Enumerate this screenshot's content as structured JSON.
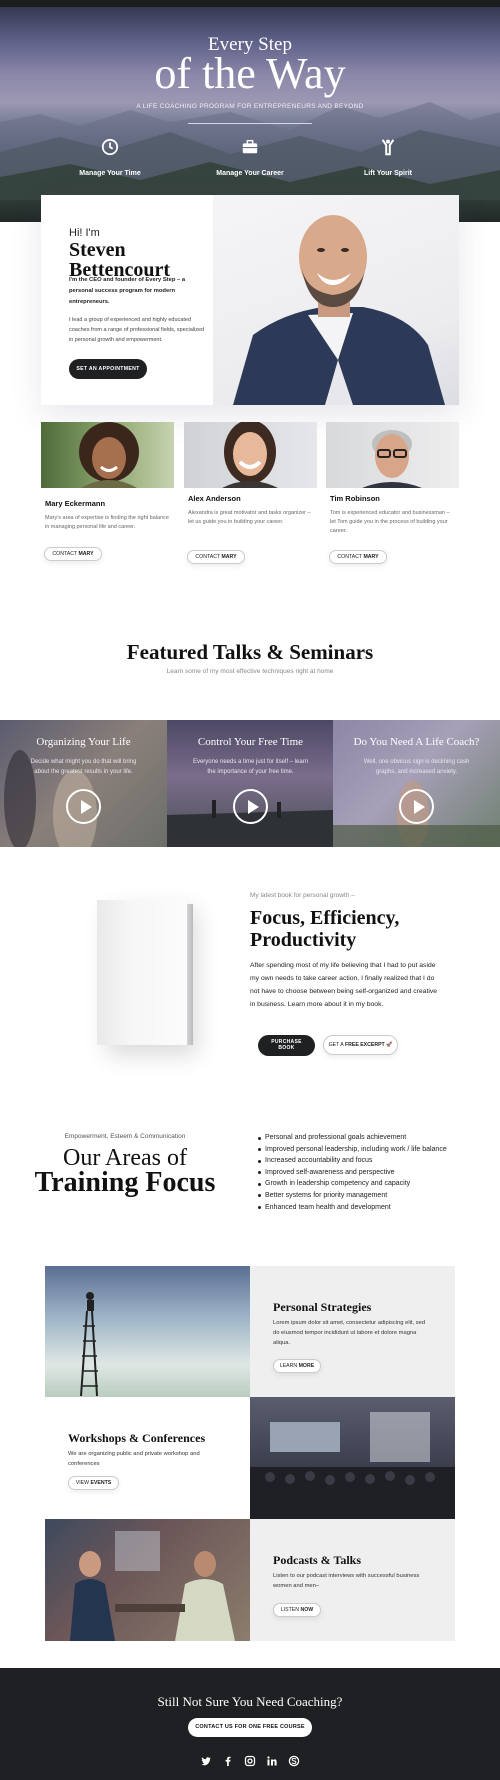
{
  "hero": {
    "title_line1": "Every Step",
    "title_line2": "of the Way",
    "subtitle": "A LIFE COACHING PROGRAM FOR ENTREPRENEURS AND BEYOND",
    "features": [
      {
        "icon": "clock-icon",
        "label": "Manage Your Time"
      },
      {
        "icon": "briefcase-icon",
        "label": "Manage Your Career"
      },
      {
        "icon": "person-raised-arms-icon",
        "label": "Lift Your Spirit"
      }
    ]
  },
  "bio": {
    "greeting": "Hi! I'm",
    "name_line1": "Steven",
    "name_line2": "Bettencourt",
    "lead": "I'm the CEO and founder of Every Step – a personal success program for modern entrepreneurs.",
    "text": "I lead a group of experienced and highly educated coaches from a range of professional fields, specialized in personal growth and empowerment.",
    "button": "SET AN APPOINTMENT"
  },
  "coaches": [
    {
      "name": "Mary Eckermann",
      "desc": "Mary's area of expertise is finding the right balance in managing personal life and career.",
      "btn_prefix": "CONTACT",
      "btn_name": "MARY"
    },
    {
      "name": "Alex Anderson",
      "desc": "Alexandra is great motivator and tasks organizer – let us guide you in building your career.",
      "btn_prefix": "CONTACT",
      "btn_name": "MARY"
    },
    {
      "name": "Tim Robinson",
      "desc": "Tom is experienced educator and businessman – let Tom guide you in the process of building your career.",
      "btn_prefix": "CONTACT",
      "btn_name": "MARY"
    }
  ],
  "featured": {
    "title": "Featured Talks & Seminars",
    "subtitle": "Learn some of my most effective techniques right at home",
    "talks": [
      {
        "title": "Organizing Your Life",
        "desc": "Decide what might you do that will bring about the greatest results in your life."
      },
      {
        "title": "Control Your Free Time",
        "desc": "Everyone needs a time just for itself – learn the importance of your free time."
      },
      {
        "title": "Do You Need A Life Coach?",
        "desc": "Well, one obvious sign is declining cash graphs, and increased anxiety."
      }
    ]
  },
  "book": {
    "kicker": "My latest book for personal growth –",
    "title": "Focus, Efficiency, Productivity",
    "text": "After spending most of my life believing that I had to put aside my own needs to take career action, I finally realized that I do not have to choose between being self-organized and creative in business. Learn more about it in my book.",
    "buy_label_line1": "PURCHASE",
    "buy_label_line2": "BOOK",
    "excerpt_prefix": "GET A",
    "excerpt_bold": "FREE EXCERPT",
    "excerpt_icon": "🚀"
  },
  "training": {
    "kicker": "Empowerment, Esteem & Communication",
    "title_line1": "Our Areas of",
    "title_line2": "Training Focus",
    "items": [
      "Personal and professional goals achievement",
      "Improved personal leadership, including work / life balance",
      "Increased accountability and focus",
      "Improved self-awareness and perspective",
      "Growth in leadership competency and capacity",
      "Better systems for priority management",
      "Enhanced team health and development"
    ]
  },
  "grid": [
    {
      "title": "Personal Strategies",
      "text": "Lorem ipsum dolor sit amet, consectetur adipiscing elit, sed do eiusmod tempor incididunt ut labore et dolore magna aliqua.",
      "btn_prefix": "LEARN",
      "btn_bold": "MORE"
    },
    {
      "title": "Workshops & Conferences",
      "text": "We are organizing public and private workshop and conferences",
      "btn_prefix": "VIEW",
      "btn_bold": "EVENTS"
    },
    {
      "title": "Podcasts & Talks",
      "text": "Listen to our podcast interviews with successful business women and men–",
      "btn_prefix": "LISTEN",
      "btn_bold": "NOW"
    }
  ],
  "footer": {
    "title": "Still Not Sure You Need Coaching?",
    "button": "CONTACT US FOR ONE FREE COURSE",
    "social": [
      "twitter-icon",
      "facebook-icon",
      "instagram-icon",
      "linkedin-icon",
      "skype-icon"
    ]
  },
  "colors": {
    "dark": "#1f2022",
    "accent_purple": "#7c78a3"
  }
}
